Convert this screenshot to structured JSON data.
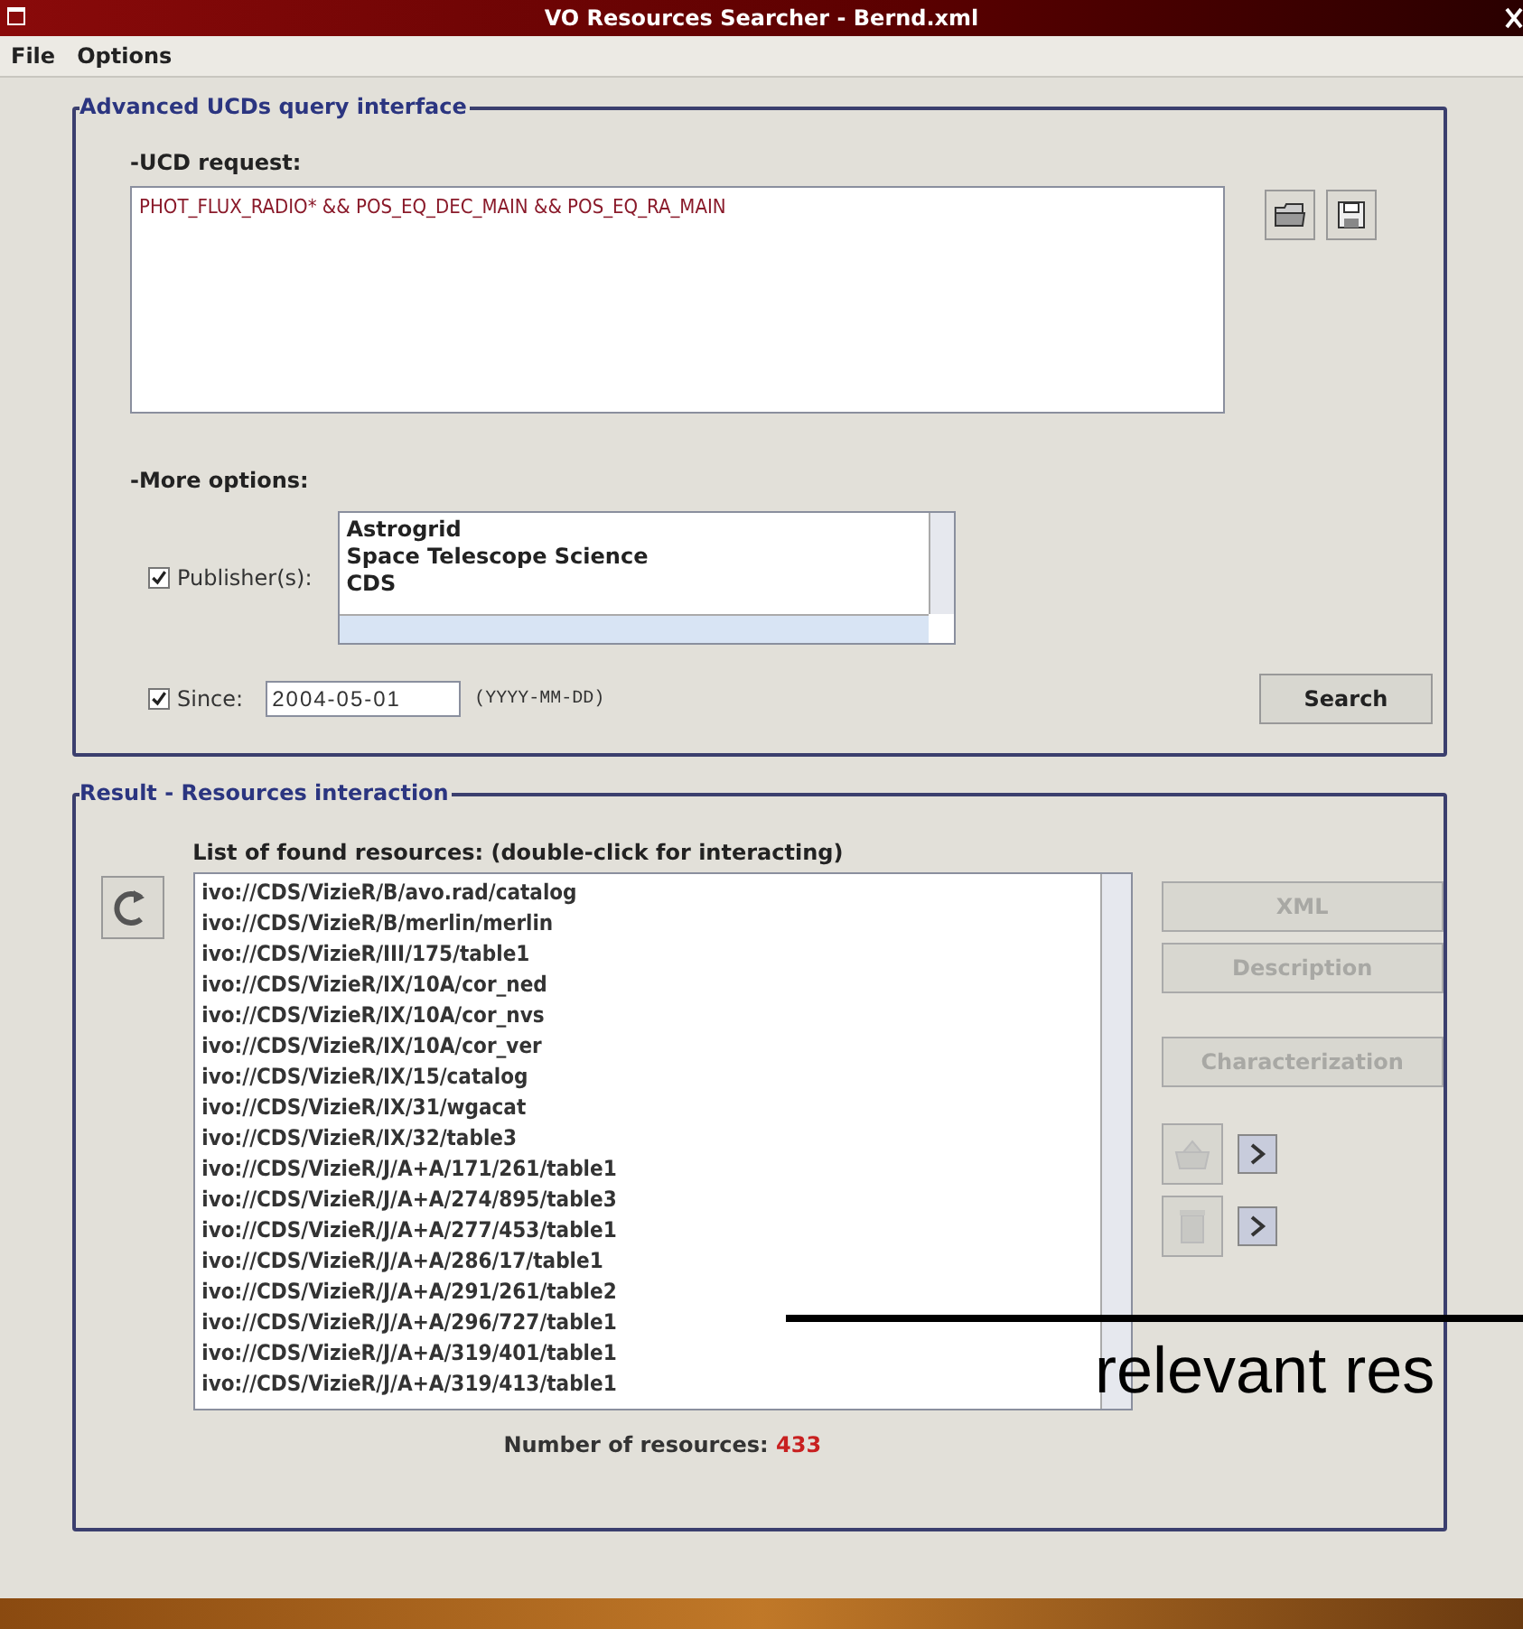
{
  "window": {
    "title": "VO Resources Searcher - Bernd.xml"
  },
  "menu": [
    "File",
    "Options"
  ],
  "query_panel": {
    "title": "Advanced UCDs query interface",
    "ucd_label": "-UCD request:",
    "ucd_request": "PHOT_FLUX_RADIO* && POS_EQ_DEC_MAIN && POS_EQ_RA_MAIN",
    "more_label": "-More options:",
    "publishers": {
      "label": "Publisher(s):",
      "checked": true,
      "items": [
        "Astrogrid",
        "Space Telescope Science",
        "CDS"
      ]
    },
    "since": {
      "label": "Since:",
      "checked": true,
      "value": "2004-05-01",
      "hint": "(YYYY-MM-DD)"
    },
    "search_button": "Search"
  },
  "result_panel": {
    "title": "Result - Resources interaction",
    "list_label": "List of found resources: (double-click for interacting)",
    "resources": [
      "ivo://CDS/VizieR/B/avo.rad/catalog",
      "ivo://CDS/VizieR/B/merlin/merlin",
      "ivo://CDS/VizieR/III/175/table1",
      "ivo://CDS/VizieR/IX/10A/cor_ned",
      "ivo://CDS/VizieR/IX/10A/cor_nvs",
      "ivo://CDS/VizieR/IX/10A/cor_ver",
      "ivo://CDS/VizieR/IX/15/catalog",
      "ivo://CDS/VizieR/IX/31/wgacat",
      "ivo://CDS/VizieR/IX/32/table3",
      "ivo://CDS/VizieR/J/A+A/171/261/table1",
      "ivo://CDS/VizieR/J/A+A/274/895/table3",
      "ivo://CDS/VizieR/J/A+A/277/453/table1",
      "ivo://CDS/VizieR/J/A+A/286/17/table1",
      "ivo://CDS/VizieR/J/A+A/291/261/table2",
      "ivo://CDS/VizieR/J/A+A/296/727/table1",
      "ivo://CDS/VizieR/J/A+A/319/401/table1",
      "ivo://CDS/VizieR/J/A+A/319/413/table1"
    ],
    "buttons": [
      {
        "label": "XML",
        "disabled": true
      },
      {
        "label": "Description",
        "disabled": true
      },
      {
        "label": "Characterization",
        "disabled": true
      }
    ],
    "count_label": "Number of resources:",
    "count": "433"
  },
  "annotation": "relevant res"
}
